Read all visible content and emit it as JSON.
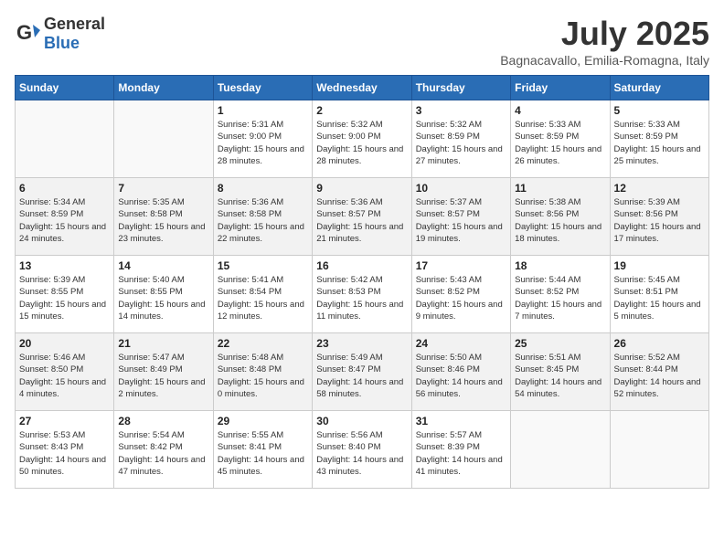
{
  "header": {
    "logo_general": "General",
    "logo_blue": "Blue",
    "month_title": "July 2025",
    "subtitle": "Bagnacavallo, Emilia-Romagna, Italy"
  },
  "days_of_week": [
    "Sunday",
    "Monday",
    "Tuesday",
    "Wednesday",
    "Thursday",
    "Friday",
    "Saturday"
  ],
  "weeks": [
    [
      {
        "day": "",
        "info": ""
      },
      {
        "day": "",
        "info": ""
      },
      {
        "day": "1",
        "info": "Sunrise: 5:31 AM\nSunset: 9:00 PM\nDaylight: 15 hours and 28 minutes."
      },
      {
        "day": "2",
        "info": "Sunrise: 5:32 AM\nSunset: 9:00 PM\nDaylight: 15 hours and 28 minutes."
      },
      {
        "day": "3",
        "info": "Sunrise: 5:32 AM\nSunset: 8:59 PM\nDaylight: 15 hours and 27 minutes."
      },
      {
        "day": "4",
        "info": "Sunrise: 5:33 AM\nSunset: 8:59 PM\nDaylight: 15 hours and 26 minutes."
      },
      {
        "day": "5",
        "info": "Sunrise: 5:33 AM\nSunset: 8:59 PM\nDaylight: 15 hours and 25 minutes."
      }
    ],
    [
      {
        "day": "6",
        "info": "Sunrise: 5:34 AM\nSunset: 8:59 PM\nDaylight: 15 hours and 24 minutes."
      },
      {
        "day": "7",
        "info": "Sunrise: 5:35 AM\nSunset: 8:58 PM\nDaylight: 15 hours and 23 minutes."
      },
      {
        "day": "8",
        "info": "Sunrise: 5:36 AM\nSunset: 8:58 PM\nDaylight: 15 hours and 22 minutes."
      },
      {
        "day": "9",
        "info": "Sunrise: 5:36 AM\nSunset: 8:57 PM\nDaylight: 15 hours and 21 minutes."
      },
      {
        "day": "10",
        "info": "Sunrise: 5:37 AM\nSunset: 8:57 PM\nDaylight: 15 hours and 19 minutes."
      },
      {
        "day": "11",
        "info": "Sunrise: 5:38 AM\nSunset: 8:56 PM\nDaylight: 15 hours and 18 minutes."
      },
      {
        "day": "12",
        "info": "Sunrise: 5:39 AM\nSunset: 8:56 PM\nDaylight: 15 hours and 17 minutes."
      }
    ],
    [
      {
        "day": "13",
        "info": "Sunrise: 5:39 AM\nSunset: 8:55 PM\nDaylight: 15 hours and 15 minutes."
      },
      {
        "day": "14",
        "info": "Sunrise: 5:40 AM\nSunset: 8:55 PM\nDaylight: 15 hours and 14 minutes."
      },
      {
        "day": "15",
        "info": "Sunrise: 5:41 AM\nSunset: 8:54 PM\nDaylight: 15 hours and 12 minutes."
      },
      {
        "day": "16",
        "info": "Sunrise: 5:42 AM\nSunset: 8:53 PM\nDaylight: 15 hours and 11 minutes."
      },
      {
        "day": "17",
        "info": "Sunrise: 5:43 AM\nSunset: 8:52 PM\nDaylight: 15 hours and 9 minutes."
      },
      {
        "day": "18",
        "info": "Sunrise: 5:44 AM\nSunset: 8:52 PM\nDaylight: 15 hours and 7 minutes."
      },
      {
        "day": "19",
        "info": "Sunrise: 5:45 AM\nSunset: 8:51 PM\nDaylight: 15 hours and 5 minutes."
      }
    ],
    [
      {
        "day": "20",
        "info": "Sunrise: 5:46 AM\nSunset: 8:50 PM\nDaylight: 15 hours and 4 minutes."
      },
      {
        "day": "21",
        "info": "Sunrise: 5:47 AM\nSunset: 8:49 PM\nDaylight: 15 hours and 2 minutes."
      },
      {
        "day": "22",
        "info": "Sunrise: 5:48 AM\nSunset: 8:48 PM\nDaylight: 15 hours and 0 minutes."
      },
      {
        "day": "23",
        "info": "Sunrise: 5:49 AM\nSunset: 8:47 PM\nDaylight: 14 hours and 58 minutes."
      },
      {
        "day": "24",
        "info": "Sunrise: 5:50 AM\nSunset: 8:46 PM\nDaylight: 14 hours and 56 minutes."
      },
      {
        "day": "25",
        "info": "Sunrise: 5:51 AM\nSunset: 8:45 PM\nDaylight: 14 hours and 54 minutes."
      },
      {
        "day": "26",
        "info": "Sunrise: 5:52 AM\nSunset: 8:44 PM\nDaylight: 14 hours and 52 minutes."
      }
    ],
    [
      {
        "day": "27",
        "info": "Sunrise: 5:53 AM\nSunset: 8:43 PM\nDaylight: 14 hours and 50 minutes."
      },
      {
        "day": "28",
        "info": "Sunrise: 5:54 AM\nSunset: 8:42 PM\nDaylight: 14 hours and 47 minutes."
      },
      {
        "day": "29",
        "info": "Sunrise: 5:55 AM\nSunset: 8:41 PM\nDaylight: 14 hours and 45 minutes."
      },
      {
        "day": "30",
        "info": "Sunrise: 5:56 AM\nSunset: 8:40 PM\nDaylight: 14 hours and 43 minutes."
      },
      {
        "day": "31",
        "info": "Sunrise: 5:57 AM\nSunset: 8:39 PM\nDaylight: 14 hours and 41 minutes."
      },
      {
        "day": "",
        "info": ""
      },
      {
        "day": "",
        "info": ""
      }
    ]
  ]
}
